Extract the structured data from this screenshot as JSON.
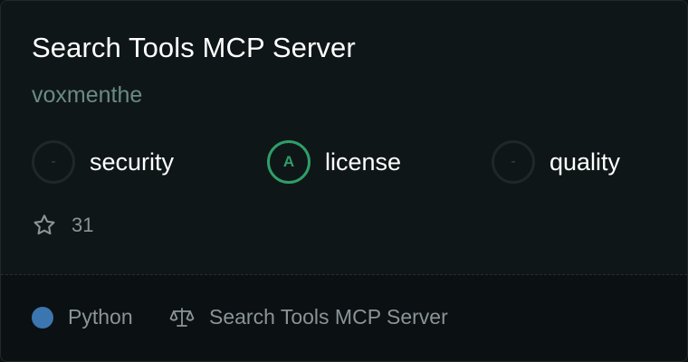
{
  "card": {
    "title": "Search Tools MCP Server",
    "author": "voxmenthe"
  },
  "scores": [
    {
      "grade": "-",
      "label": "security"
    },
    {
      "grade": "A",
      "label": "license"
    },
    {
      "grade": "-",
      "label": "quality"
    }
  ],
  "stars": {
    "icon": "star-icon",
    "count": "31"
  },
  "footer": {
    "language": "Python",
    "language_color": "#3b76b0",
    "license_icon": "scale-icon",
    "license_text": "Search Tools MCP Server"
  },
  "colors": {
    "grade_a": "#2f9e68",
    "author": "#6a8a84"
  }
}
